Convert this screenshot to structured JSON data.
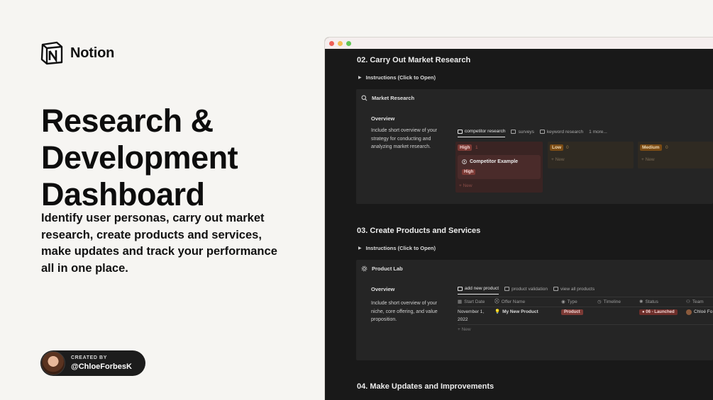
{
  "brand": {
    "name": "Notion"
  },
  "hero": {
    "title": "Research & Development Dashboard",
    "subtitle": "Identify user personas, carry out market research, create products and services, make updates and track your performance all in one place."
  },
  "creator": {
    "label": "CREATED BY",
    "handle": "@ChloeForbesK"
  },
  "window": {
    "sections": [
      {
        "title": "02. Carry Out Market Research",
        "toggle": "Instructions (Click to Open)"
      },
      {
        "title": "03. Create Products and Services",
        "toggle": "Instructions (Click to Open)"
      },
      {
        "title": "04. Make Updates and Improvements"
      }
    ],
    "market": {
      "panel_title": "Market Research",
      "overview_title": "Overview",
      "overview_text": "Include short overview of your strategy for conducting and analyzing market research.",
      "tabs": [
        "competitor research",
        "surveys",
        "keyword research",
        "1 more..."
      ],
      "columns": [
        {
          "tag": "High",
          "count": "1",
          "color": "#7c3a35"
        },
        {
          "tag": "Low",
          "count": "0",
          "color": "#7a4b14"
        },
        {
          "tag": "Medium",
          "count": "0",
          "color": "#7a4b14"
        }
      ],
      "card": {
        "title": "Competitor Example",
        "tag": "High"
      },
      "new_label": "+ New"
    },
    "product": {
      "panel_title": "Product Lab",
      "overview_title": "Overview",
      "overview_text": "Include short overview of your niche, core offering, and value proposition.",
      "tabs": [
        "add new product",
        "product validation",
        "view all products"
      ],
      "headers": [
        "Start Date",
        "Offer Name",
        "Type",
        "Timeline",
        "Status",
        "Team"
      ],
      "row": {
        "start_date": "November 1, 2022",
        "offer_name": "My New Product",
        "type": "Product",
        "status": "06 - Launched",
        "team": "Chloé Fo"
      },
      "new_label": "+ New"
    }
  },
  "colors": {
    "accent_red": "#7c3a35",
    "accent_orange": "#7a4b14",
    "window_bg": "#191919"
  }
}
